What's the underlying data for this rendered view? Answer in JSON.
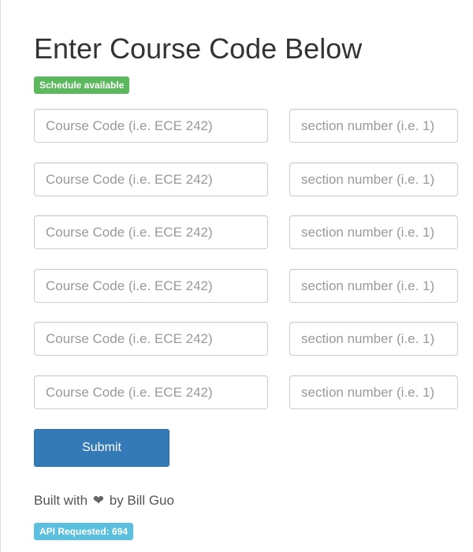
{
  "page": {
    "title": "Enter Course Code Below",
    "schedule_badge": "Schedule available"
  },
  "form": {
    "course_placeholder": "Course Code (i.e. ECE 242)",
    "section_placeholder": "section number (i.e. 1)",
    "rows": [
      {
        "course": "",
        "section": ""
      },
      {
        "course": "",
        "section": ""
      },
      {
        "course": "",
        "section": ""
      },
      {
        "course": "",
        "section": ""
      },
      {
        "course": "",
        "section": ""
      },
      {
        "course": "",
        "section": ""
      }
    ],
    "submit_label": "Submit"
  },
  "footer": {
    "built_with": "Built with",
    "heart_icon": "heart-icon",
    "by": "by Bill Guo",
    "api_badge": "API Requested: 694"
  },
  "colors": {
    "success": "#5cb85c",
    "info": "#5bc0de",
    "primary": "#337ab7"
  }
}
